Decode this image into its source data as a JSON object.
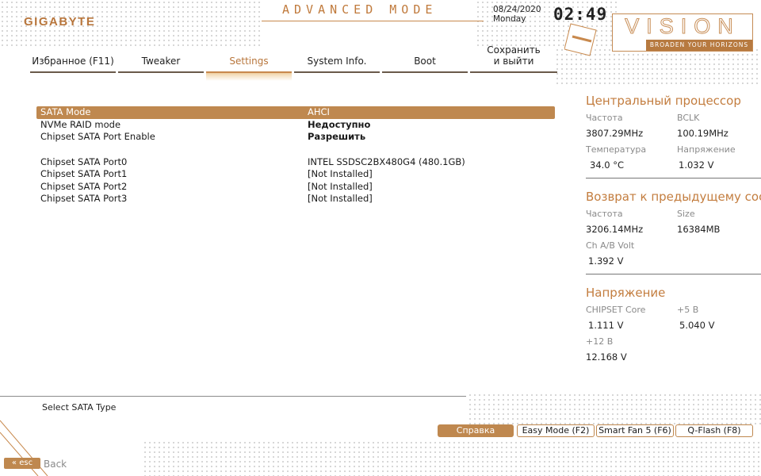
{
  "header": {
    "brand": "GIGABYTE",
    "mode_title": "ADVANCED MODE",
    "date": "08/24/2020",
    "weekday": "Monday",
    "time": "02:49",
    "vision_word": "VISION",
    "vision_tagline": "BROADEN YOUR HORIZONS"
  },
  "tabs": [
    {
      "label": "Избранное (F11)",
      "active": false
    },
    {
      "label": "Tweaker",
      "active": false
    },
    {
      "label": "Settings",
      "active": true
    },
    {
      "label": "System Info.",
      "active": false
    },
    {
      "label": "Boot",
      "active": false
    },
    {
      "label": "Сохранить и выйти",
      "line1": "Сохранить",
      "line2": "и выйти",
      "active": false
    }
  ],
  "settings": [
    {
      "label": "SATA Mode",
      "value": "AHCI",
      "selected": true
    },
    {
      "label": "NVMe RAID mode",
      "value": "Недоступно"
    },
    {
      "label": "Chipset SATA Port Enable",
      "value": "Разрешить"
    },
    {
      "label": "Chipset SATA Port0",
      "value": "INTEL SSDSC2BX480G4 (480.1GB)"
    },
    {
      "label": "Chipset SATA Port1",
      "value": "[Not Installed]"
    },
    {
      "label": "Chipset SATA Port2",
      "value": "[Not Installed]"
    },
    {
      "label": "Chipset SATA Port3",
      "value": "[Not Installed]"
    }
  ],
  "sidebar": {
    "cpu": {
      "title": "Центральный процессор",
      "freq_label": "Частота",
      "freq_value": "3807.29MHz",
      "bclk_label": "BCLK",
      "bclk_value": "100.19MHz",
      "temp_label": "Температура",
      "temp_value": "34.0 °C",
      "volt_label": "Напряжение",
      "volt_value": "1.032 V"
    },
    "memory": {
      "title": "Возврат к предыдущему состоянию",
      "freq_label": "Частота",
      "freq_value": "3206.14MHz",
      "size_label": "Size",
      "size_value": "16384MB",
      "volt_label": "Ch A/B Volt",
      "volt_value": "1.392 V"
    },
    "voltage": {
      "title": "Напряжение",
      "chipset_label": "CHIPSET Core",
      "chipset_value": "1.111 V",
      "p5_label": "+5 В",
      "p5_value": "5.040 V",
      "p12_label": "+12 В",
      "p12_value": "12.168 V"
    }
  },
  "footer": {
    "help_text": "Select SATA Type",
    "buttons": [
      "Справка",
      "Easy Mode (F2)",
      "Smart Fan 5 (F6)",
      "Q-Flash (F8)"
    ],
    "esc_label": "esc",
    "back_label": "Back"
  },
  "colors": {
    "accent": "#bf884f",
    "accent_text": "#c37d3f"
  }
}
